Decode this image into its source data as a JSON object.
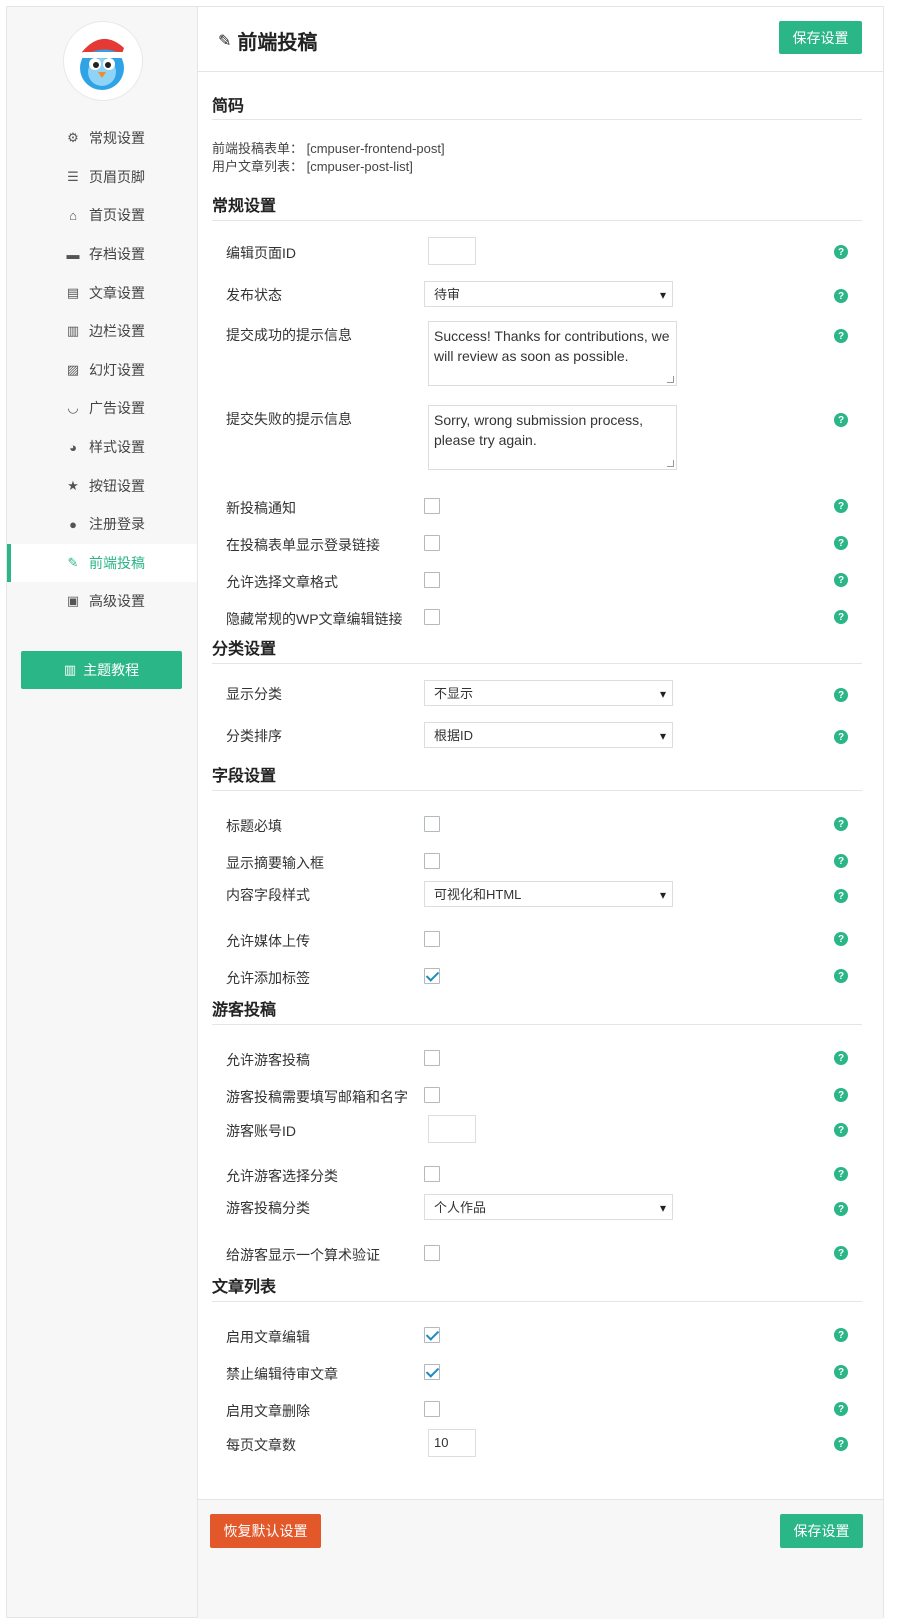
{
  "sidebar": {
    "items": [
      {
        "label": "常规设置",
        "icon": "gear-icon",
        "glyph": "⚙",
        "active": false
      },
      {
        "label": "页眉页脚",
        "icon": "header-footer-icon",
        "glyph": "☰",
        "active": false
      },
      {
        "label": "首页设置",
        "icon": "home-icon",
        "glyph": "⌂",
        "active": false
      },
      {
        "label": "存档设置",
        "icon": "folder-icon",
        "glyph": "▬",
        "active": false
      },
      {
        "label": "文章设置",
        "icon": "post-icon",
        "glyph": "▤",
        "active": false
      },
      {
        "label": "边栏设置",
        "icon": "sidebar-icon",
        "glyph": "▥",
        "active": false
      },
      {
        "label": "幻灯设置",
        "icon": "slides-icon",
        "glyph": "▨",
        "active": false
      },
      {
        "label": "广告设置",
        "icon": "smile-icon",
        "glyph": "◡",
        "active": false
      },
      {
        "label": "样式设置",
        "icon": "palette-icon",
        "glyph": "◕",
        "active": false
      },
      {
        "label": "按钮设置",
        "icon": "star-icon",
        "glyph": "★",
        "active": false
      },
      {
        "label": "注册登录",
        "icon": "user-icon",
        "glyph": "●",
        "active": false
      },
      {
        "label": "前端投稿",
        "icon": "pencil-icon",
        "glyph": "✎",
        "active": true
      },
      {
        "label": "高级设置",
        "icon": "advanced-icon",
        "glyph": "▣",
        "active": false
      }
    ],
    "guide_label": "主题教程"
  },
  "header": {
    "title": "前端投稿",
    "save_label": "保存设置"
  },
  "shortcode": {
    "title": "简码",
    "line1": "前端投稿表单： [cmpuser-frontend-post]",
    "line2": "用户文章列表： [cmpuser-post-list]"
  },
  "general": {
    "title": "常规设置",
    "edit_page_id_label": "编辑页面ID",
    "edit_page_id_value": "",
    "publish_status_label": "发布状态",
    "publish_status_value": "待审",
    "success_msg_label": "提交成功的提示信息",
    "success_msg_value": "Success! Thanks for contributions, we will review as soon as possible.",
    "fail_msg_label": "提交失败的提示信息",
    "fail_msg_value": "Sorry, wrong submission process, please try again.",
    "new_post_notify_label": "新投稿通知",
    "show_login_link_label": "在投稿表单显示登录链接",
    "allow_post_format_label": "允许选择文章格式",
    "hide_wp_edit_link_label": "隐藏常规的WP文章编辑链接"
  },
  "category": {
    "title": "分类设置",
    "show_category_label": "显示分类",
    "show_category_value": "不显示",
    "category_order_label": "分类排序",
    "category_order_value": "根据ID"
  },
  "fields": {
    "title": "字段设置",
    "title_required_label": "标题必填",
    "show_excerpt_label": "显示摘要输入框",
    "content_style_label": "内容字段样式",
    "content_style_value": "可视化和HTML",
    "allow_media_label": "允许媒体上传",
    "allow_tags_label": "允许添加标签"
  },
  "guest": {
    "title": "游客投稿",
    "allow_guest_label": "允许游客投稿",
    "require_email_name_label": "游客投稿需要填写邮箱和名字",
    "guest_account_id_label": "游客账号ID",
    "guest_account_id_value": "",
    "allow_guest_category_label": "允许游客选择分类",
    "guest_category_label": "游客投稿分类",
    "guest_category_value": "个人作品",
    "math_captcha_label": "给游客显示一个算术验证"
  },
  "post_list": {
    "title": "文章列表",
    "enable_edit_label": "启用文章编辑",
    "disable_pending_edit_label": "禁止编辑待审文章",
    "enable_delete_label": "启用文章删除",
    "per_page_label": "每页文章数",
    "per_page_value": "10"
  },
  "footer": {
    "reset_label": "恢复默认设置",
    "save_label": "保存设置"
  },
  "colors": {
    "accent": "#2bb687",
    "reset": "#e2582b",
    "check": "#1e8cbe"
  },
  "help_glyph": "?"
}
